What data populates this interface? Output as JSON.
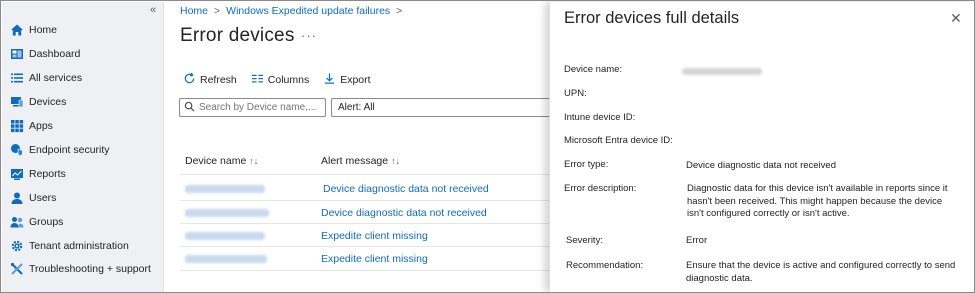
{
  "sidebar": {
    "collapse_glyph": "«",
    "items": [
      {
        "label": "Home",
        "icon": "home-icon",
        "color": "#0f6cbd"
      },
      {
        "label": "Dashboard",
        "icon": "dashboard-icon",
        "color": "#0f6cbd"
      },
      {
        "label": "All services",
        "icon": "list-icon",
        "color": "#0f6cbd"
      },
      {
        "label": "Devices",
        "icon": "devices-icon",
        "color": "#0f6cbd"
      },
      {
        "label": "Apps",
        "icon": "apps-grid-icon",
        "color": "#0f6cbd"
      },
      {
        "label": "Endpoint security",
        "icon": "shield-icon",
        "color": "#0f6cbd"
      },
      {
        "label": "Reports",
        "icon": "reports-icon",
        "color": "#0f6cbd"
      },
      {
        "label": "Users",
        "icon": "user-icon",
        "color": "#0f6cbd"
      },
      {
        "label": "Groups",
        "icon": "groups-icon",
        "color": "#0f6cbd"
      },
      {
        "label": "Tenant administration",
        "icon": "gear-icon",
        "color": "#0f6cbd"
      },
      {
        "label": "Troubleshooting + support",
        "icon": "tools-icon",
        "color": "#0f6cbd"
      }
    ]
  },
  "breadcrumb": {
    "home": "Home",
    "sep": ">",
    "report": "Windows Expedited update failures"
  },
  "page": {
    "title": "Error devices",
    "more": "···"
  },
  "toolbar": {
    "refresh": "Refresh",
    "columns": "Columns",
    "export": "Export"
  },
  "search": {
    "placeholder": "Search by Device name,..."
  },
  "filter": {
    "label": "Alert: All"
  },
  "table": {
    "headers": {
      "device": "Device name",
      "alert": "Alert message",
      "device_sort": "↑↓",
      "alert_sort": "↑↓"
    },
    "rows": [
      {
        "alert": "Device diagnostic data not received"
      },
      {
        "alert": "Device diagnostic data not received"
      },
      {
        "alert": "Expedite client missing"
      },
      {
        "alert": "Expedite client missing"
      }
    ]
  },
  "panel": {
    "title": "Error devices full details",
    "close": "✕",
    "fields": {
      "device_name": "Device name:",
      "upn": "UPN:",
      "intune_id": "Intune device ID:",
      "entra_id": "Microsoft Entra device ID:",
      "error_type": "Error type:",
      "error_type_value": "Device diagnostic data not received",
      "error_description": "Error description:",
      "error_description_value": "Diagnostic data for this device isn't available in reports since it hasn't been received. This might happen because the device isn't configured correctly or isn't active.",
      "severity": "Severity:",
      "severity_value": "Error",
      "recommendation": "Recommendation:",
      "recommendation_value": "Ensure that the device is active and configured correctly to send diagnostic data."
    }
  },
  "colors": {
    "link": "#0f6cbd",
    "sidebar_bg": "#eef0f3"
  }
}
